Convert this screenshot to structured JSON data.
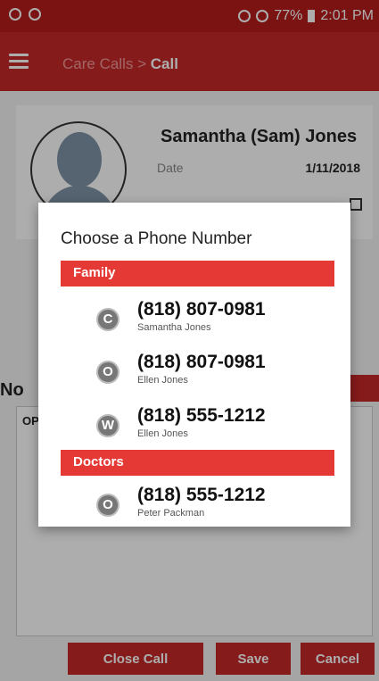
{
  "status_bar": {
    "battery": "77%",
    "time": "2:01 PM"
  },
  "app_bar": {
    "crumb_parent": "Care Calls > ",
    "crumb_current": "Call"
  },
  "profile": {
    "name": "Samantha (Sam) Jones",
    "date_label": "Date",
    "date_value": "1/11/2018"
  },
  "notes": {
    "label": "No",
    "text": "OP"
  },
  "buttons": {
    "close_call": "Close Call",
    "save": "Save",
    "cancel": "Cancel"
  },
  "dialog": {
    "title": "Choose a Phone Number",
    "sections": [
      {
        "label": "Family",
        "entries": [
          {
            "type": "C",
            "number": "(818) 807-0981",
            "name": "Samantha Jones"
          },
          {
            "type": "O",
            "number": "(818) 807-0981",
            "name": "Ellen Jones"
          },
          {
            "type": "W",
            "number": "(818) 555-1212",
            "name": "Ellen Jones"
          }
        ]
      },
      {
        "label": "Doctors",
        "entries": [
          {
            "type": "O",
            "number": "(818) 555-1212",
            "name": "Peter Packman"
          }
        ]
      }
    ]
  },
  "colors": {
    "primary": "#c62828",
    "status": "#b71c1c",
    "section": "#e53935"
  }
}
